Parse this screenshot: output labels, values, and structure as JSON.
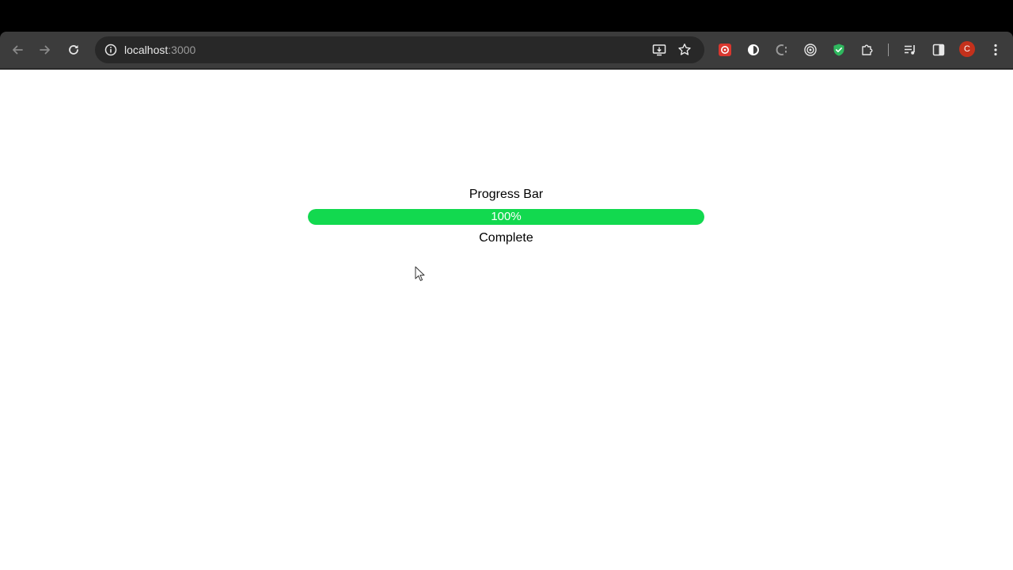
{
  "browser": {
    "address_bar": {
      "host": "localhost",
      "port": ":3000"
    },
    "profile_initial": "C",
    "icons": {
      "back": "arrow-left-icon",
      "forward": "arrow-right-icon",
      "reload": "reload-icon",
      "site_info": "info-circle-icon",
      "install_app": "install-app-icon",
      "bookmark": "star-icon",
      "extensions": [
        "red-extension-icon",
        "circle-extension-icon",
        "c-extension-icon",
        "target-extension-icon",
        "shield-check-extension-icon",
        "puzzle-icon"
      ],
      "media": "media-queue-icon",
      "side_panel": "side-panel-icon",
      "menu": "kebab-menu-icon"
    },
    "colors": {
      "toolbar": "#3c3c3c",
      "omnibox": "#282828",
      "avatar": "#c4311c",
      "shield_extension": "#2fb85e",
      "red_extension": "#d9372f"
    }
  },
  "page": {
    "progress": {
      "title": "Progress Bar",
      "value_percent": 100,
      "label": "100%",
      "status": "Complete",
      "fill_color": "#12d94f",
      "track_color": "#e6e6e6"
    }
  }
}
